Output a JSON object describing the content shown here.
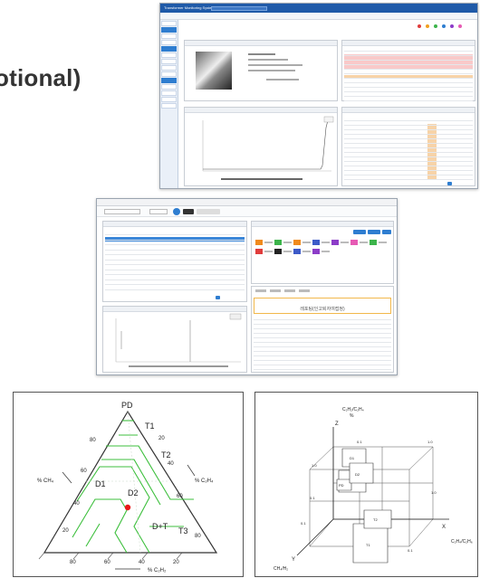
{
  "heading": {
    "text": "otional)"
  },
  "screen1": {
    "title": "Transformer Monitoring System",
    "colors": {
      "titlebar": "#1f5aa8",
      "sidebar_active": "#2e7dd0"
    },
    "legend_dots": [
      "#e03c3c",
      "#f0a020",
      "#3cb44b",
      "#2e7dd0",
      "#8c3cc8",
      "#e65ab4"
    ],
    "table_rows": 12,
    "highlight_column": "orange",
    "line_chart": {
      "type": "line",
      "shape": "flat then sharp rise at end"
    }
  },
  "screen2": {
    "status_buttons": [
      {
        "color": "#f08a1c"
      },
      {
        "color": "#3cb44b"
      },
      {
        "color": "#f08a1c"
      },
      {
        "color": "#3c5ac8"
      },
      {
        "color": "#8c3cc8"
      },
      {
        "color": "#e65ab4"
      },
      {
        "color": "#3cb44b"
      },
      {
        "color": "#e03c3c"
      },
      {
        "color": "#222222"
      },
      {
        "color": "#3c5ac8"
      },
      {
        "color": "#8c3cc8"
      }
    ],
    "banner_text": "레포팅(인고퇴자여접정)"
  },
  "duval_triangle": {
    "apex_label": "PD",
    "zone_labels": [
      "T1",
      "T2",
      "T3",
      "D1",
      "D2",
      "D+T"
    ],
    "left_axis_label": "% CH₄",
    "right_axis_label": "% C₂H₄",
    "bottom_axis_label": "% C₂H₂",
    "left_ticks": [
      "80",
      "60",
      "40",
      "20"
    ],
    "right_ticks": [
      "20",
      "40",
      "60",
      "80"
    ],
    "bottom_ticks": [
      "80",
      "60",
      "40",
      "20"
    ],
    "point_color": "#e81818",
    "line_color": "#3cbf3c"
  },
  "cube_chart": {
    "y_top_label": "C₂H₂/C₂H₄",
    "y_top_sub": "%",
    "x_label": "C₂H₄/C₂H₆",
    "z_label": "CH₄/H₂",
    "axis_letters": [
      "Z",
      "X",
      "Y"
    ],
    "box_labels": [
      "D1",
      "D2",
      "PD",
      "T1",
      "T2"
    ],
    "tick_labels": [
      "0.1",
      "1.0",
      "1.0",
      "0.1",
      "0.1",
      "1.0",
      "0.1"
    ]
  }
}
